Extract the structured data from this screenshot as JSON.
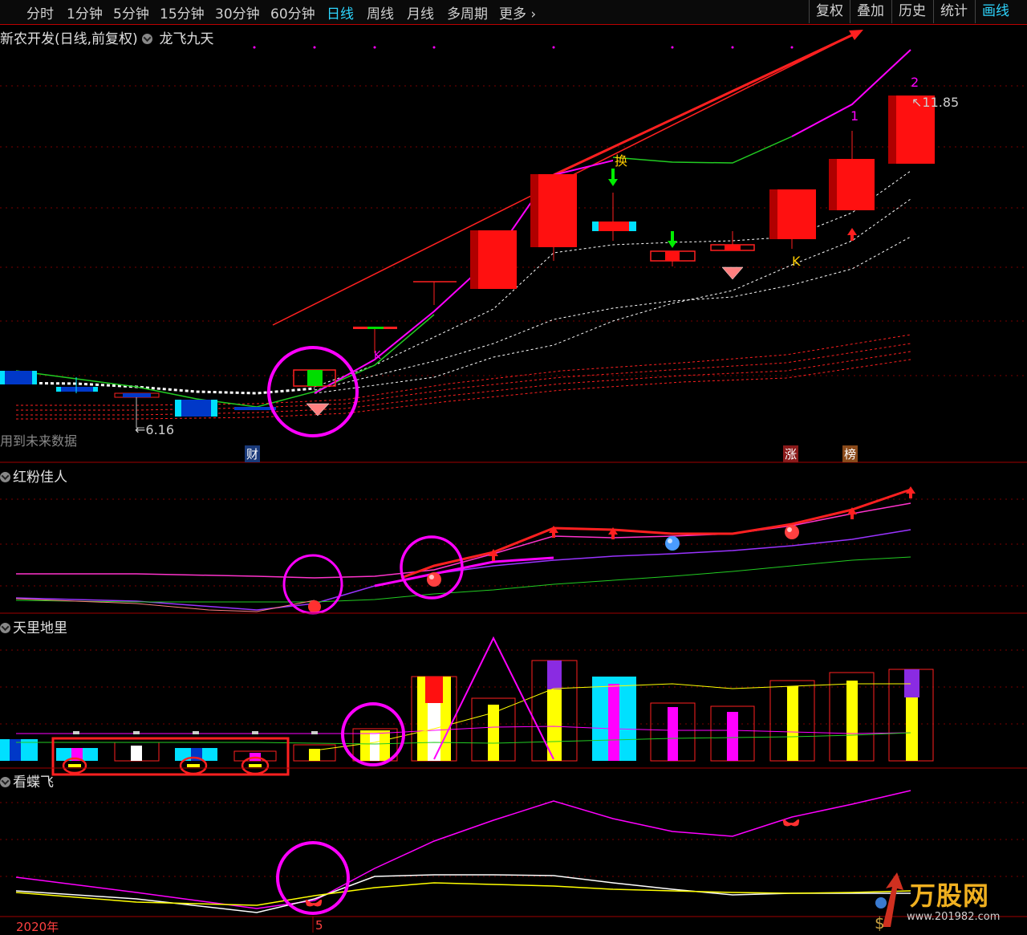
{
  "toolbar": {
    "periods": [
      "分时",
      "1分钟",
      "5分钟",
      "15分钟",
      "30分钟",
      "60分钟",
      "日线",
      "周线",
      "月线",
      "多周期",
      "更多"
    ],
    "active_period": "日线",
    "buttons": [
      "复权",
      "叠加",
      "历史",
      "统计",
      "画线"
    ],
    "active_button": "画线"
  },
  "chart": {
    "title": "新农开发(日线,前复权)",
    "indicator": "龙飞九天",
    "future_note": "用到未来数据",
    "low_label": "6.16",
    "high_label": "11.85",
    "wave_labels": [
      "1",
      "2"
    ],
    "k_label": "K",
    "huan_label": "换",
    "event_tags": [
      "财",
      "涨",
      "榜"
    ]
  },
  "panels": {
    "p2_title": "红粉佳人",
    "p3_title": "天里地里",
    "p4_title": "看蝶飞"
  },
  "xaxis": {
    "year_label": "2020年",
    "month_label": "5"
  },
  "watermark": {
    "brand": "万股网",
    "url": "www.201982.com"
  },
  "colors": {
    "up": "#ff2020",
    "down": "#00e0ff",
    "magenta": "#ff00ff",
    "grid": "#8b0000",
    "active": "#2ed6ff"
  }
}
